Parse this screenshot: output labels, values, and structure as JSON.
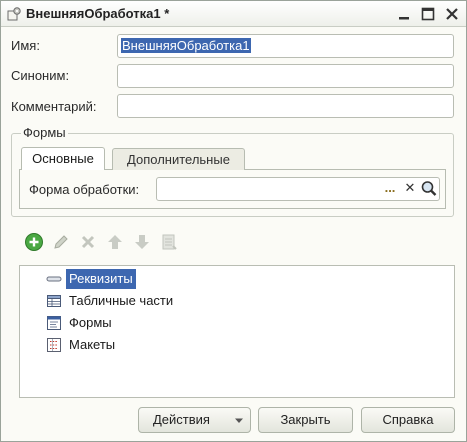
{
  "window": {
    "title": "ВнешняяОбработка1 *"
  },
  "form": {
    "name_label": "Имя:",
    "name_value": "ВнешняяОбработка1",
    "synonym_label": "Синоним:",
    "synonym_value": "",
    "comment_label": "Комментарий:",
    "comment_value": ""
  },
  "forms_group": {
    "title": "Формы",
    "tabs": [
      {
        "label": "Основные",
        "active": true
      },
      {
        "label": "Дополнительные",
        "active": false
      }
    ],
    "processing_form_label": "Форма обработки:",
    "processing_form_value": "",
    "ellipsis_label": "...",
    "clear_label": "✕"
  },
  "tree": {
    "items": [
      {
        "label": "Реквизиты",
        "icon": "attribute-icon",
        "selected": true
      },
      {
        "label": "Табличные части",
        "icon": "tabular-section-icon",
        "selected": false
      },
      {
        "label": "Формы",
        "icon": "form-icon",
        "selected": false
      },
      {
        "label": "Макеты",
        "icon": "template-icon",
        "selected": false
      }
    ]
  },
  "toolbar": {
    "icons": [
      "add-icon",
      "edit-icon",
      "delete-icon",
      "move-up-icon",
      "move-down-icon",
      "sort-icon"
    ]
  },
  "footer": {
    "actions_label": "Действия",
    "close_label": "Закрыть",
    "help_label": "Справка"
  },
  "colors": {
    "selection": "#3d67b0",
    "add_green": "#3f9a3a"
  }
}
